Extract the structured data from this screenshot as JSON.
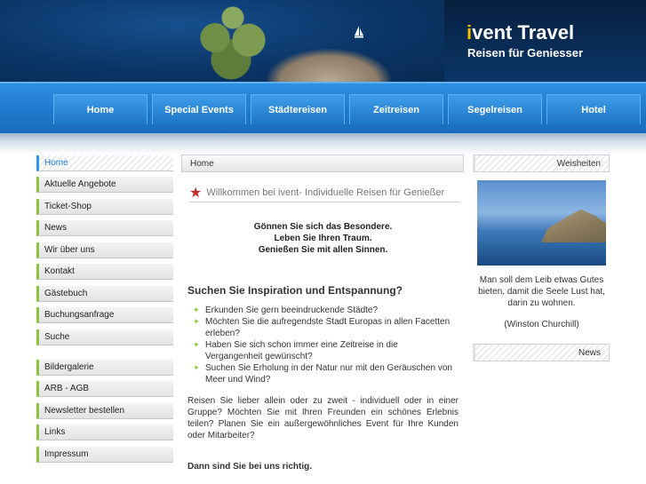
{
  "brand": {
    "title_prefix": "i",
    "title_rest": "vent Travel",
    "tagline": "Reisen für Geniesser"
  },
  "nav": [
    "Home",
    "Special Events",
    "Städtereisen",
    "Zeitreisen",
    "Segelreisen",
    "Hotel"
  ],
  "sidebar": {
    "group1": [
      "Home",
      "Aktuelle Angebote",
      "Ticket-Shop",
      "News",
      "Wir über uns",
      "Kontakt",
      "Gästebuch",
      "Buchungsanfrage",
      "Suche"
    ],
    "group2": [
      "Bildergalerie",
      "ARB - AGB",
      "Newsletter bestellen",
      "Links",
      "Impressum"
    ]
  },
  "content": {
    "breadcrumb": "Home",
    "welcome": "Willkommen bei ivent- Individuelle Reisen für Genießer",
    "motto": [
      "Gönnen Sie sich das Besondere.",
      "Leben Sie Ihren Traum.",
      "Genießen Sie mit allen Sinnen."
    ],
    "heading": "Suchen Sie Inspiration und Entspannung?",
    "bullets": [
      "Erkunden Sie gern beeindruckende Städte?",
      "Möchten Sie die aufregendste Stadt Europas in allen Facetten erleben?",
      "Haben Sie sich schon immer eine Zeitreise in die Vergangenheit gewünscht?",
      "Suchen Sie Erholung in der Natur nur mit den Geräuschen von Meer und Wind?"
    ],
    "questions": "Reisen Sie lieber allein oder zu zweit - individuell oder in einer Gruppe? Möchten Sie mit Ihren Freunden ein schönes Erlebnis teilen? Planen Sie ein außergewöhnliches Event für Ihre Kunden oder Mitarbeiter?",
    "closing": "Dann sind Sie bei uns richtig."
  },
  "right": {
    "box1": "Weisheiten",
    "quote": "Man soll dem Leib etwas Gutes bieten, damit die Seele Lust hat, darin zu wohnen.",
    "author": "(Winston Churchill)",
    "box2": "News"
  },
  "colors": {
    "nav_blue": "#1f78cc",
    "accent_green": "#8cc63f",
    "active_blue": "#2b9ae8",
    "star_red": "#c0302f",
    "logo_yellow": "#f0c000"
  }
}
